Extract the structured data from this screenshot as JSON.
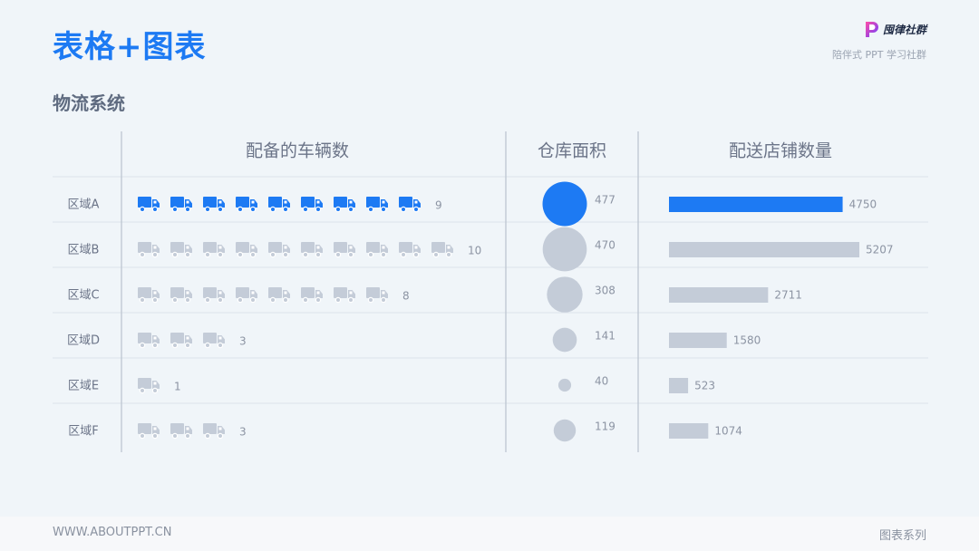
{
  "header": {
    "title": "表格+图表",
    "brand_name": "囤律社群",
    "brand_slogan": "陪伴式 PPT 学习社群",
    "brand_icon": "purple-p-logo-icon"
  },
  "section_title": "物流系统",
  "footer": {
    "website": "WWW.ABOUTPPT.CN",
    "series": "图表系列"
  },
  "colors": {
    "highlight": "#1d7af3",
    "muted": "#c4ccd8",
    "text": "#6b7488",
    "value_text": "#8c94a3",
    "grid": "#dde3ea"
  },
  "chart_data": {
    "type": "table",
    "columns": [
      "配备的车辆数",
      "仓库面积",
      "配送店铺数量"
    ],
    "rows": [
      "区域A",
      "区域B",
      "区域C",
      "区域D",
      "区域E",
      "区域F"
    ],
    "highlight_row": "区域A",
    "vehicles": [
      9,
      10,
      8,
      3,
      1,
      3
    ],
    "warehouse_area": [
      477,
      470,
      308,
      141,
      40,
      119
    ],
    "store_count": [
      4750,
      5207,
      2711,
      1580,
      523,
      1074
    ],
    "vehicle_icon": "truck-icon"
  }
}
